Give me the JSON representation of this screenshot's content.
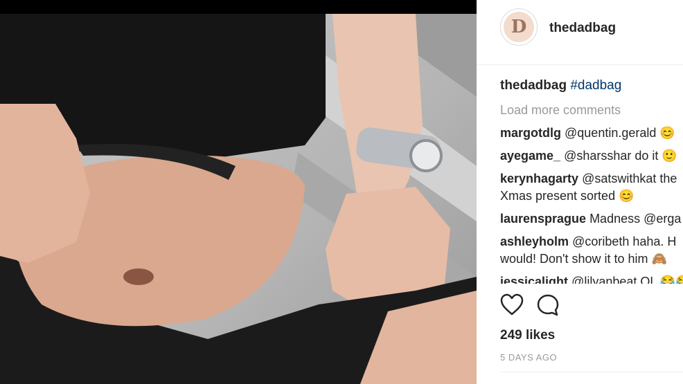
{
  "post": {
    "username": "thedadbag",
    "avatar_letter": "D",
    "caption": {
      "username": "thedadbag",
      "text": "#dadbag"
    },
    "load_more": "Load more comments",
    "comments": [
      {
        "username": "margotdlg",
        "text": "@quentin.gerald 😊"
      },
      {
        "username": "ayegame_",
        "text": "@sharsshar do it 🙂"
      },
      {
        "username": "kerynhagarty",
        "text": "@satswithkat the",
        "text2": "Xmas present sorted 😊"
      },
      {
        "username": "laurensprague",
        "text": "Madness @erga"
      },
      {
        "username": "ashleyholm",
        "text": "@coribeth haha. H",
        "text2": "would! Don't show it to him 🙈"
      },
      {
        "username": "jessicalight",
        "text": "@lilyanbeat OL 😂😂😂"
      }
    ],
    "likes": "249 likes",
    "timestamp": "5 DAYS AGO"
  },
  "icons": {
    "like": "heart-icon",
    "comment": "comment-bubble-icon"
  },
  "colors": {
    "link": "#003569",
    "muted": "#999999",
    "text": "#262626"
  }
}
